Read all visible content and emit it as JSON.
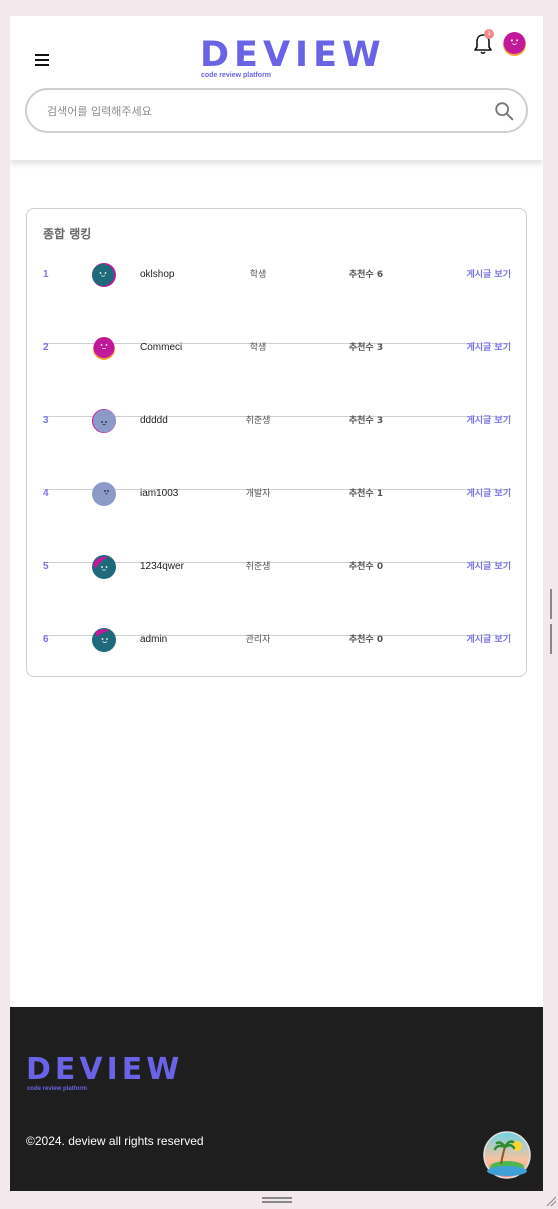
{
  "header": {
    "logo_text": "DEVIEW",
    "logo_subtitle": "code review platform",
    "notification_count": "1",
    "search_placeholder": "검색어를 입력해주세요"
  },
  "ranking": {
    "title": "종합 랭킹",
    "rows": [
      {
        "rank": "1",
        "username": "oklshop",
        "role": "학생",
        "recommend": "추천수 6",
        "view": "게시글 보기",
        "avatar": "teal"
      },
      {
        "rank": "2",
        "username": "Commeci",
        "role": "학생",
        "recommend": "추천수 3",
        "view": "게시글 보기",
        "avatar": "magenta"
      },
      {
        "rank": "3",
        "username": "ddddd",
        "role": "취준생",
        "recommend": "추천수 3",
        "view": "게시글 보기",
        "avatar": "lavender"
      },
      {
        "rank": "4",
        "username": "iam1003",
        "role": "개발자",
        "recommend": "추천수 1",
        "view": "게시글 보기",
        "avatar": "lavender"
      },
      {
        "rank": "5",
        "username": "1234qwer",
        "role": "취준생",
        "recommend": "추천수 0",
        "view": "게시글 보기",
        "avatar": "teal"
      },
      {
        "rank": "6",
        "username": "admin",
        "role": "관리자",
        "recommend": "추천수 0",
        "view": "게시글 보기",
        "avatar": "teal"
      }
    ]
  },
  "footer": {
    "logo_text": "DEVIEW",
    "logo_subtitle": "code review platform",
    "copyright": "©2024. deview all rights reserved"
  },
  "colors": {
    "brand": "#6a63e6",
    "accent_link": "#7b74e8",
    "footer_bg": "#1e1e1e",
    "avatar_teal": "#1e6a7a",
    "avatar_magenta": "#c2189a",
    "avatar_lavender": "#8c9ac8"
  },
  "icons": [
    "menu-icon",
    "bell-icon",
    "search-icon",
    "avatar-icon",
    "island-icon"
  ]
}
